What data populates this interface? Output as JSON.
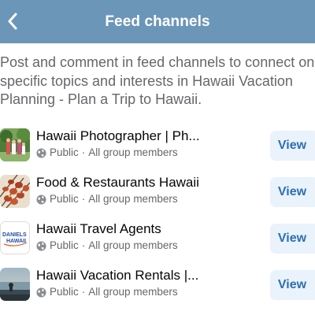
{
  "header": {
    "title": "Feed channels",
    "back_icon": "chevron-left-icon"
  },
  "description": {
    "lines": [
      "Post and comment in feed channels to connect on",
      "specific topics and interests in Hawaii Vacation",
      "Planning - Plan a Trip to Hawaii."
    ]
  },
  "channels": [
    {
      "name": "Hawaii Photographer | Ph...",
      "privacy": "Public",
      "separator": "·",
      "audience": "All group members",
      "button": "View"
    },
    {
      "name": "Food & Restaurants Hawaii",
      "privacy": "Public",
      "separator": "·",
      "audience": "All group members",
      "button": "View"
    },
    {
      "name": "Hawaii Travel Agents",
      "privacy": "Public",
      "separator": "·",
      "audience": "All group members",
      "button": "View",
      "thumb_text": [
        "DANIELS",
        "HAWAII"
      ]
    },
    {
      "name": "Hawaii Vacation Rentals |...",
      "privacy": "Public",
      "separator": "·",
      "audience": "All group members",
      "button": "View"
    }
  ],
  "colors": {
    "header_bg": "#6c96b8",
    "button_bg": "#eaf2fb",
    "button_text": "#2d6fb4",
    "secondary_text": "#65676b"
  }
}
